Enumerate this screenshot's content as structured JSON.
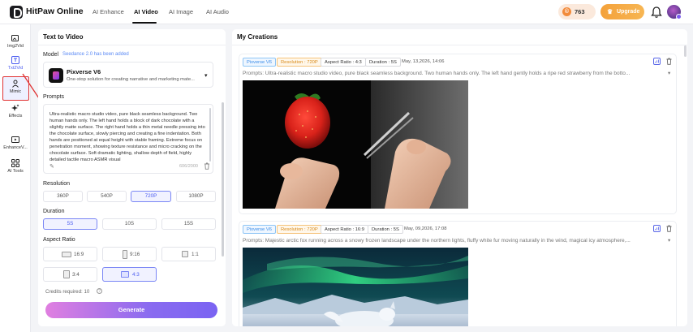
{
  "app": {
    "name": "HitPaw Online"
  },
  "nav_tabs": [
    {
      "label": "AI Enhance"
    },
    {
      "label": "AI Video"
    },
    {
      "label": "AI Image"
    },
    {
      "label": "AI Audio"
    }
  ],
  "header": {
    "credits": "763",
    "upgrade_label": "Upgrade"
  },
  "sidebar": {
    "items": [
      {
        "label": "Img2Vid",
        "icon": "image-to-video-icon"
      },
      {
        "label": "Txt2Vid",
        "icon": "text-to-video-icon"
      },
      {
        "label": "Mimic",
        "icon": "person-icon"
      },
      {
        "label": "Effects",
        "icon": "sparkle-icon"
      },
      {
        "label": "EnhanceV...",
        "icon": "enhance-video-icon"
      },
      {
        "label": "AI Tools",
        "icon": "grid-icon"
      }
    ]
  },
  "left_panel": {
    "title": "Text to Video",
    "model_label": "Model",
    "model_note": "Seedance 2.0 has been added",
    "model_name": "Pixverse V6",
    "model_desc": "One-stop solution for creating narrative and marketing mate...",
    "prompts_label": "Prompts",
    "prompt_text": "Ultra-realistic macro studio video, pure black seamless background. Two human hands only. The left hand holds a block of dark chocolate with a slightly matte surface. The right hand holds a thin metal needle pressing into the chocolate surface, slowly piercing and creating a fine indentation. Both hands are positioned at equal height with stable framing. Extreme focus on penetration moment, showing texture resistance and micro cracking on the chocolate surface. Soft dramatic lighting, shallow depth of field, highly detailed tactile macro ASMR visual",
    "prompt_count": "606/2000",
    "resolution_label": "Resolution",
    "resolutions": [
      "360P",
      "540P",
      "720P",
      "1080P"
    ],
    "resolution_selected": "720P",
    "duration_label": "Duration",
    "durations": [
      "5S",
      "10S",
      "15S"
    ],
    "duration_selected": "5S",
    "aspect_label": "Aspect Ratio",
    "aspects": [
      "16:9",
      "9:16",
      "1:1",
      "3:4",
      "4:3"
    ],
    "aspect_selected": "4:3",
    "credits_required": "Credits required: 10",
    "generate_label": "Generate"
  },
  "right_panel": {
    "title": "My Creations",
    "cards": [
      {
        "model": "Pixverse V6",
        "resolution": "Resolution : 720P",
        "aspect": "Aspect Ratio : 4:3",
        "duration": "Duration : 5S",
        "date": "May, 13,2026, 14:06",
        "prompt": "Prompts: Ultra-realistic macro studio video, pure black seamless background. Two human hands only. The left hand gently holds a ripe red strawberry from the botto..."
      },
      {
        "model": "Pixverse V6",
        "resolution": "Resolution : 720P",
        "aspect": "Aspect Ratio : 16:9",
        "duration": "Duration : 5S",
        "date": "May, 09,2026, 17:08",
        "prompt": "Prompts: Majestic arctic fox running across a snowy frozen landscape under the northern lights, fluffy white fur moving naturally in the wind, magical icy atmosphere,..."
      }
    ]
  }
}
